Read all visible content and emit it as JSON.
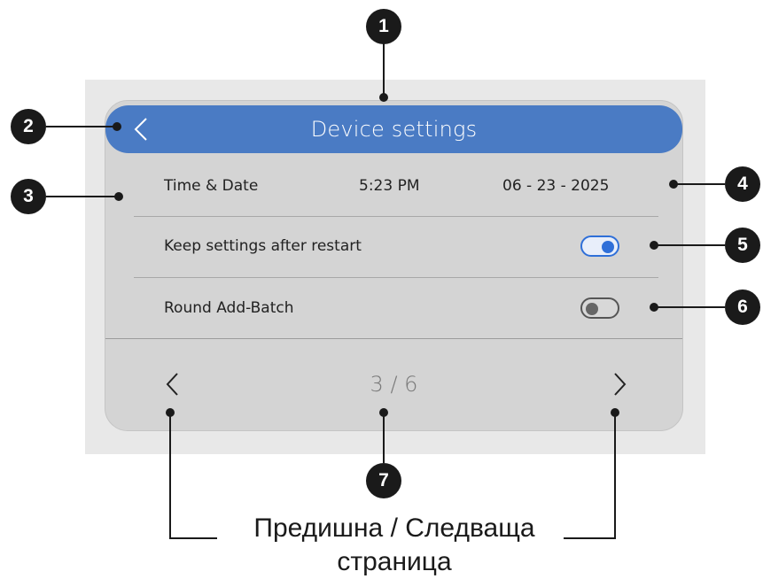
{
  "header": {
    "title": "Device settings",
    "back_icon": "chevron-left-icon"
  },
  "settings": {
    "time_date": {
      "label": "Time & Date",
      "time": "5:23 PM",
      "date": "06 - 23 - 2025"
    },
    "keep_settings": {
      "label": "Keep settings after restart",
      "enabled": true
    },
    "round_add_batch": {
      "label": "Round Add-Batch",
      "enabled": false
    }
  },
  "pagination": {
    "indicator": "3 / 6",
    "current": 3,
    "total": 6,
    "prev_icon": "chevron-left-icon",
    "next_icon": "chevron-right-icon"
  },
  "callouts": [
    "1",
    "2",
    "3",
    "4",
    "5",
    "6",
    "7"
  ],
  "caption": {
    "line1": "Предишна / Следваща",
    "line2": "страница"
  },
  "colors": {
    "header": "#4a7bc4",
    "toggle_on": "#2f6fd8",
    "panel": "#d4d4d4",
    "frame": "#e8e8e8",
    "callout": "#1a1a1a"
  }
}
